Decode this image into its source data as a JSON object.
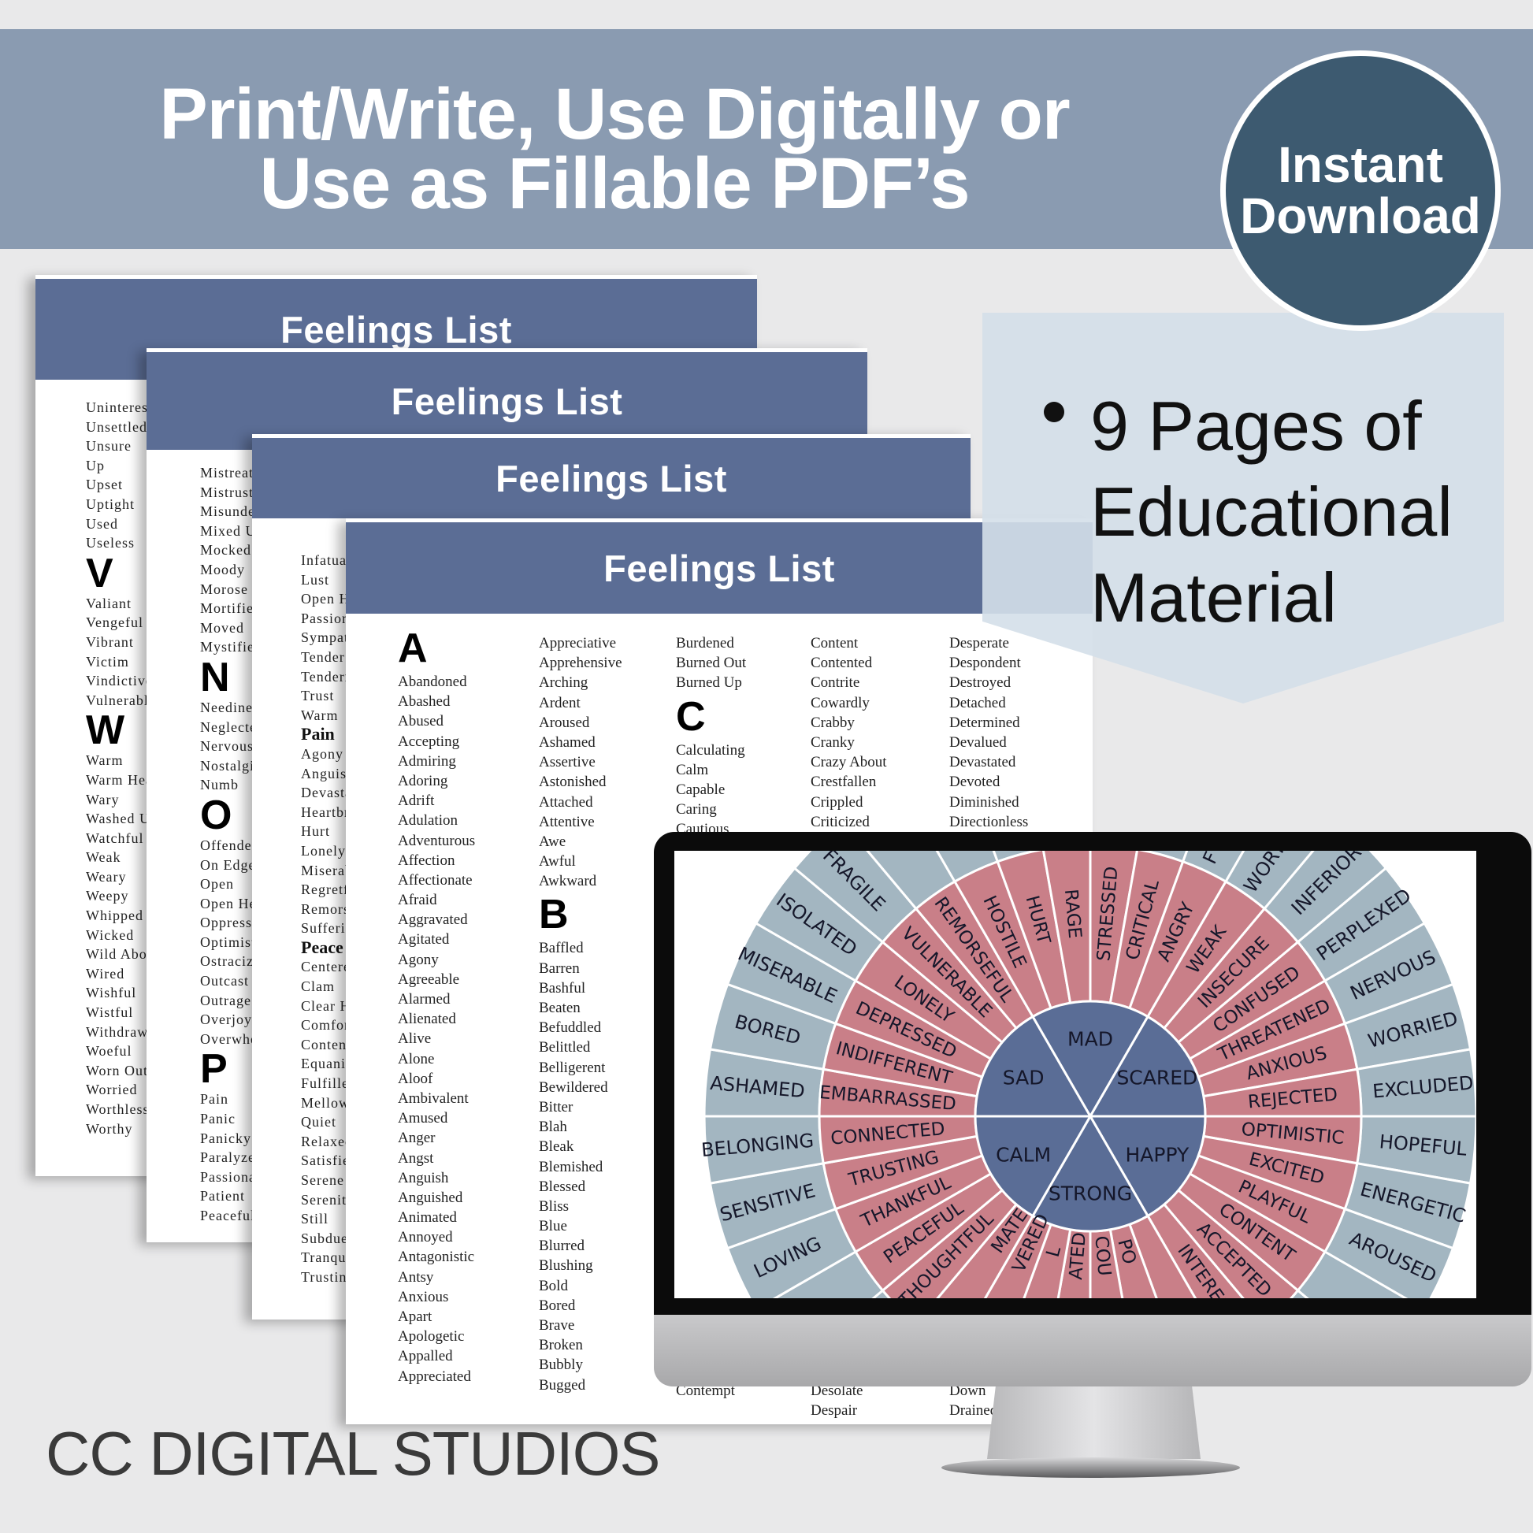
{
  "banner": {
    "line1": "Print/Write, Use Digitally or",
    "line2": "Use as Fillable PDF’s"
  },
  "badge": {
    "line1": "Instant",
    "line2": "Download"
  },
  "ribbon": {
    "lines": [
      "9 Pages of",
      "Educational",
      "Material"
    ]
  },
  "colors": {
    "banner": "#8a9bb1",
    "page_header": "#5b6d95",
    "badge": "#3d5a70",
    "ring_core": "#5a6d96",
    "ring_middle": "#c97f88",
    "ring_outer": "#a3b6c1"
  },
  "pages": [
    {
      "header": "Feelings List",
      "columns": [
        [
          {
            "word": "Uninterest"
          },
          {
            "word": "Unsettled"
          },
          {
            "word": "Unsure"
          },
          {
            "word": "Up"
          },
          {
            "word": "Upset"
          },
          {
            "word": "Uptight"
          },
          {
            "word": "Used"
          },
          {
            "word": "Useless"
          },
          {
            "letter": "V"
          },
          {
            "word": "Valiant"
          },
          {
            "word": "Vengeful"
          },
          {
            "word": "Vibrant"
          },
          {
            "word": "Victim"
          },
          {
            "word": "Vindictive"
          },
          {
            "word": "Vulnerable"
          },
          {
            "letter": "W"
          },
          {
            "word": "Warm"
          },
          {
            "word": "Warm Hea"
          },
          {
            "word": "Wary"
          },
          {
            "word": "Washed U"
          },
          {
            "word": "Watchful"
          },
          {
            "word": "Weak"
          },
          {
            "word": "Weary"
          },
          {
            "word": "Weepy"
          },
          {
            "word": "Whipped"
          },
          {
            "word": "Wicked"
          },
          {
            "word": "Wild Abou"
          },
          {
            "word": "Wired"
          },
          {
            "word": "Wishful"
          },
          {
            "word": "Wistful"
          },
          {
            "word": "Withdrawn"
          },
          {
            "word": "Woeful"
          },
          {
            "word": "Worn Out"
          },
          {
            "word": "Worried"
          },
          {
            "word": "Worthless"
          },
          {
            "word": "Worthy"
          }
        ]
      ]
    },
    {
      "header": "Feelings List",
      "columns": [
        [
          {
            "word": "Mistreate"
          },
          {
            "word": "Mistrustf"
          },
          {
            "word": "Misunder"
          },
          {
            "word": "Mixed U"
          },
          {
            "word": "Mocked"
          },
          {
            "word": "Moody"
          },
          {
            "word": "Morose"
          },
          {
            "word": "Mortified"
          },
          {
            "word": "Moved"
          },
          {
            "word": "Mystified"
          },
          {
            "letter": "N"
          },
          {
            "word": "Needines"
          },
          {
            "word": "Neglecte"
          },
          {
            "word": "Nervous"
          },
          {
            "word": "Nostalgic"
          },
          {
            "word": "Numb"
          },
          {
            "letter": "O"
          },
          {
            "word": "Offended"
          },
          {
            "word": "On Edge"
          },
          {
            "word": "Open"
          },
          {
            "word": "Open He"
          },
          {
            "word": "Oppresse"
          },
          {
            "word": "Optimist"
          },
          {
            "word": "Ostracize"
          },
          {
            "word": "Outcast"
          },
          {
            "word": "Outrage"
          },
          {
            "word": "Overjoye"
          },
          {
            "word": "Overwhe"
          },
          {
            "letter": "P"
          },
          {
            "word": "Pain"
          },
          {
            "word": "Panic"
          },
          {
            "word": "Panicky"
          },
          {
            "word": "Paralyze"
          },
          {
            "word": "Passiona"
          },
          {
            "word": "Patient"
          },
          {
            "word": "Peaceful"
          }
        ]
      ]
    },
    {
      "header": "Feelings List",
      "columns": [
        [
          {
            "word": "Infatuat"
          },
          {
            "word": "Lust"
          },
          {
            "word": "Open H"
          },
          {
            "word": "Passiona"
          },
          {
            "word": "Sympat"
          },
          {
            "word": "Tender"
          },
          {
            "word": "Tendern"
          },
          {
            "word": "Trust"
          },
          {
            "word": "Warm"
          },
          {
            "subheading": "Pain"
          },
          {
            "word": "Agony"
          },
          {
            "word": "Anguish"
          },
          {
            "word": "Devasta"
          },
          {
            "word": "Heartbr"
          },
          {
            "word": "Hurt"
          },
          {
            "word": "Lonely"
          },
          {
            "word": "Miserab"
          },
          {
            "word": "Regretf"
          },
          {
            "word": "Remors"
          },
          {
            "word": "Sufferin"
          },
          {
            "subheading": "Peace"
          },
          {
            "word": "Centere"
          },
          {
            "word": "Clam"
          },
          {
            "word": "Clear H"
          },
          {
            "word": "Comfor"
          },
          {
            "word": "Content"
          },
          {
            "word": "Equanin"
          },
          {
            "word": "Fulfilled"
          },
          {
            "word": "Mellow"
          },
          {
            "word": "Quiet"
          },
          {
            "word": "Relaxed"
          },
          {
            "word": "Satisfie"
          },
          {
            "word": "Serene"
          },
          {
            "word": "Serenity"
          },
          {
            "word": "Still"
          },
          {
            "word": "Subdued"
          },
          {
            "word": "Tranqui"
          },
          {
            "word": "Trusting"
          }
        ]
      ]
    },
    {
      "header": "Feelings List",
      "columns": [
        [
          {
            "letter": "A"
          },
          {
            "word": "Abandoned"
          },
          {
            "word": "Abashed"
          },
          {
            "word": "Abused"
          },
          {
            "word": "Accepting"
          },
          {
            "word": "Admiring"
          },
          {
            "word": "Adoring"
          },
          {
            "word": "Adrift"
          },
          {
            "word": "Adulation"
          },
          {
            "word": "Adventurous"
          },
          {
            "word": "Affection"
          },
          {
            "word": "Affectionate"
          },
          {
            "word": "Afraid"
          },
          {
            "word": "Aggravated"
          },
          {
            "word": "Agitated"
          },
          {
            "word": "Agony"
          },
          {
            "word": "Agreeable"
          },
          {
            "word": "Alarmed"
          },
          {
            "word": "Alienated"
          },
          {
            "word": "Alive"
          },
          {
            "word": "Alone"
          },
          {
            "word": "Aloof"
          },
          {
            "word": "Ambivalent"
          },
          {
            "word": "Amused"
          },
          {
            "word": "Anger"
          },
          {
            "word": "Angst"
          },
          {
            "word": "Anguish"
          },
          {
            "word": "Anguished"
          },
          {
            "word": "Animated"
          },
          {
            "word": "Annoyed"
          },
          {
            "word": "Antagonistic"
          },
          {
            "word": "Antsy"
          },
          {
            "word": "Anxious"
          },
          {
            "word": "Apart"
          },
          {
            "word": "Apologetic"
          },
          {
            "word": "Appalled"
          },
          {
            "word": "Appreciated"
          }
        ],
        [
          {
            "word": "Appreciative"
          },
          {
            "word": "Apprehensive"
          },
          {
            "word": "Arching"
          },
          {
            "word": "Ardent"
          },
          {
            "word": "Aroused"
          },
          {
            "word": "Ashamed"
          },
          {
            "word": "Assertive"
          },
          {
            "word": "Astonished"
          },
          {
            "word": "Attached"
          },
          {
            "word": "Attentive"
          },
          {
            "word": "Awe"
          },
          {
            "word": "Awful"
          },
          {
            "word": "Awkward"
          },
          {
            "letter": "B"
          },
          {
            "word": "Baffled"
          },
          {
            "word": "Barren"
          },
          {
            "word": "Bashful"
          },
          {
            "word": "Beaten"
          },
          {
            "word": "Befuddled"
          },
          {
            "word": "Belittled"
          },
          {
            "word": "Belligerent"
          },
          {
            "word": "Bewildered"
          },
          {
            "word": "Bitter"
          },
          {
            "word": "Blah"
          },
          {
            "word": "Bleak"
          },
          {
            "word": "Blemished"
          },
          {
            "word": "Blessed"
          },
          {
            "word": "Bliss"
          },
          {
            "word": "Blue"
          },
          {
            "word": "Blurred"
          },
          {
            "word": "Blushing"
          },
          {
            "word": "Bold"
          },
          {
            "word": "Bored"
          },
          {
            "word": "Brave"
          },
          {
            "word": "Broken"
          },
          {
            "word": "Bubbly"
          },
          {
            "word": "Bugged"
          }
        ],
        [
          {
            "word": "Burdened"
          },
          {
            "word": "Burned Out"
          },
          {
            "word": "Burned Up"
          },
          {
            "letter": "C"
          },
          {
            "word": "Calculating"
          },
          {
            "word": "Calm"
          },
          {
            "word": "Capable"
          },
          {
            "word": "Caring"
          },
          {
            "word": "Cautious"
          }
        ],
        [
          {
            "word": "Content"
          },
          {
            "word": "Contented"
          },
          {
            "word": "Contrite"
          },
          {
            "word": "Cowardly"
          },
          {
            "word": "Crabby"
          },
          {
            "word": "Cranky"
          },
          {
            "word": "Crazy About"
          },
          {
            "word": "Crestfallen"
          },
          {
            "word": "Crippled"
          },
          {
            "word": "Criticized"
          }
        ],
        [
          {
            "word": "Desperate"
          },
          {
            "word": "Despondent"
          },
          {
            "word": "Destroyed"
          },
          {
            "word": "Detached"
          },
          {
            "word": "Determined"
          },
          {
            "word": "Devalued"
          },
          {
            "word": "Devastated"
          },
          {
            "word": "Devoted"
          },
          {
            "word": "Diminished"
          },
          {
            "word": "Directionless"
          }
        ]
      ],
      "bottom_columns": [
        [],
        [],
        [
          "Contempt"
        ],
        [
          "Desolate",
          "Despair"
        ],
        [
          "Down",
          "Drained"
        ]
      ]
    }
  ],
  "wheel": {
    "core": [
      "MAD",
      "SCARED",
      "HAPPY",
      "STRONG",
      "CALM",
      "SAD"
    ],
    "middle": [
      "OPTIMISTIC",
      "EXCITED",
      "PLAYFUL",
      "CONTENT",
      "ACCEPTED",
      "INTEREST",
      "",
      "PO",
      "COU",
      "ATED",
      "L",
      "VERED",
      "MATE",
      "THOUGHTFUL",
      "PEACEFUL",
      "THANKFUL",
      "TRUSTING",
      "CONNECTED",
      "EMBARRASSED",
      "INDIFFERENT",
      "DEPRESSED",
      "LONELY",
      "VULNERABLE",
      "REMORSEFUL",
      "HOSTILE",
      "HURT",
      "RAGE",
      "STRESSED",
      "CRITICAL",
      "ANGRY",
      "WEAK",
      "INSECURE",
      "CONFUSED",
      "THREATENED",
      "ANXIOUS",
      "REJECTED"
    ],
    "outer": [
      "HOPEFUL",
      "ENERGETIC",
      "AROUSED",
      "",
      "",
      "",
      "",
      "",
      "",
      "",
      "",
      "",
      "",
      "",
      "",
      "LOVING",
      "SENSITIVE",
      "BELONGING",
      "ASHAMED",
      "BORED",
      "MISERABLE",
      "ISOLATED",
      "FRAGILE",
      "",
      "",
      "",
      "",
      "",
      "",
      "F",
      "WORT",
      "INFERIOR",
      "PERPLEXED",
      "NERVOUS",
      "WORRIED",
      "EXCLUDED"
    ]
  },
  "footer": "CC DIGITAL STUDIOS"
}
